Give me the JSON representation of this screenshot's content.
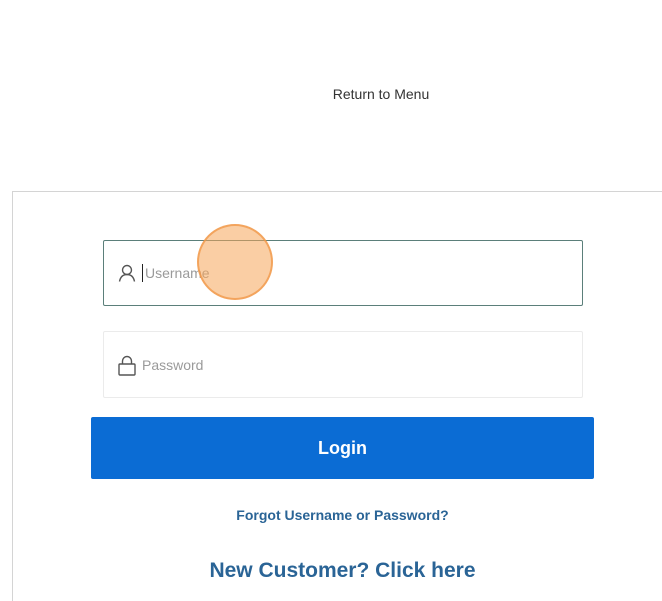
{
  "header": {
    "return_link": "Return to Menu"
  },
  "login_form": {
    "username": {
      "placeholder": "Username",
      "value": "",
      "icon": "user-icon"
    },
    "password": {
      "placeholder": "Password",
      "value": "",
      "icon": "lock-icon"
    },
    "login_button_label": "Login",
    "forgot_link": "Forgot Username or Password?",
    "new_customer_link": "New Customer? Click here"
  },
  "colors": {
    "primary_button": "#0b6cd4",
    "link": "#2a6496",
    "focused_border": "#5b7f7a",
    "touch_indicator": "#f5a65a"
  }
}
